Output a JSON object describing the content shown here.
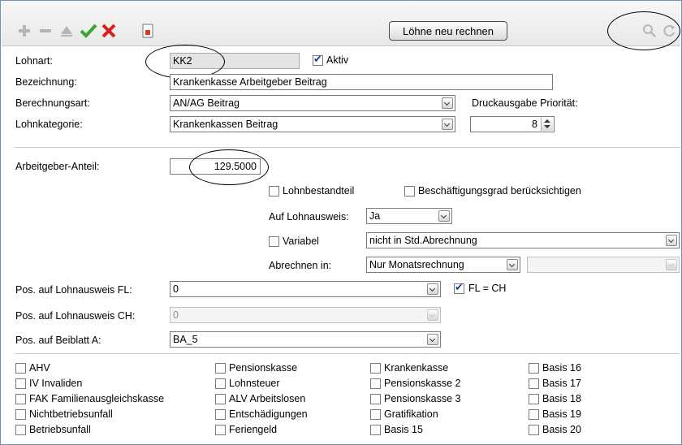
{
  "toolbar": {
    "add_icon": "plus-icon",
    "remove_icon": "minus-icon",
    "up_icon": "triangle-up-icon",
    "confirm_icon": "checkmark-icon",
    "cancel_icon": "red-x-icon",
    "export_icon": "document-export-icon",
    "recalc_label": "Löhne neu rechnen",
    "search_icon": "magnifier-icon",
    "refresh_icon": "refresh-icon"
  },
  "form": {
    "lohnart": {
      "label": "Lohnart:",
      "value": "KK2"
    },
    "aktiv": {
      "label": "Aktiv",
      "checked": true
    },
    "bezeichnung": {
      "label": "Bezeichnung:",
      "value": "Krankenkasse Arbeitgeber Beitrag"
    },
    "berechnungsart": {
      "label": "Berechnungsart:",
      "value": "AN/AG Beitrag"
    },
    "druckausgabe": {
      "label": "Druckausgabe Priorität:",
      "value": "8"
    },
    "lohnkategorie": {
      "label": "Lohnkategorie:",
      "value": "Krankenkassen Beitrag"
    },
    "arbeitgeber_anteil": {
      "label": "Arbeitgeber-Anteil:",
      "value": "129.5000"
    },
    "lohnbestandteil": {
      "label": "Lohnbestandteil",
      "checked": false
    },
    "beschaeftigungsgrad": {
      "label": "Beschäftigungsgrad berücksichtigen",
      "checked": false
    },
    "auf_lohnausweis": {
      "label": "Auf Lohnausweis:",
      "value": "Ja"
    },
    "variabel": {
      "label": "Variabel",
      "checked": false,
      "value": "nicht in Std.Abrechnung"
    },
    "abrechnen_in": {
      "label": "Abrechnen in:",
      "value": "Nur Monatsrechnung",
      "value2": ""
    },
    "pos_fl": {
      "label": "Pos. auf Lohnausweis FL:",
      "value": "0"
    },
    "fl_ch": {
      "label": "FL = CH",
      "checked": true
    },
    "pos_ch": {
      "label": "Pos. auf Lohnausweis CH:",
      "value": "0"
    },
    "pos_beiblatt": {
      "label": "Pos. auf Beiblatt A:",
      "value": "BA_5"
    }
  },
  "bases": {
    "col1": [
      "AHV",
      "IV Invaliden",
      "FAK Familienausgleichskasse",
      "Nichtbetriebsunfall",
      "Betriebsunfall"
    ],
    "col2": [
      "Pensionskasse",
      "Lohnsteuer",
      "ALV Arbeitslosen",
      "Entschädigungen",
      "Feriengeld"
    ],
    "col3": [
      "Krankenkasse",
      "Pensionskasse 2",
      "Pensionskasse 3",
      "Gratifikation",
      "Basis 15"
    ],
    "col4": [
      "Basis 16",
      "Basis 17",
      "Basis 18",
      "Basis 19",
      "Basis 20"
    ]
  }
}
